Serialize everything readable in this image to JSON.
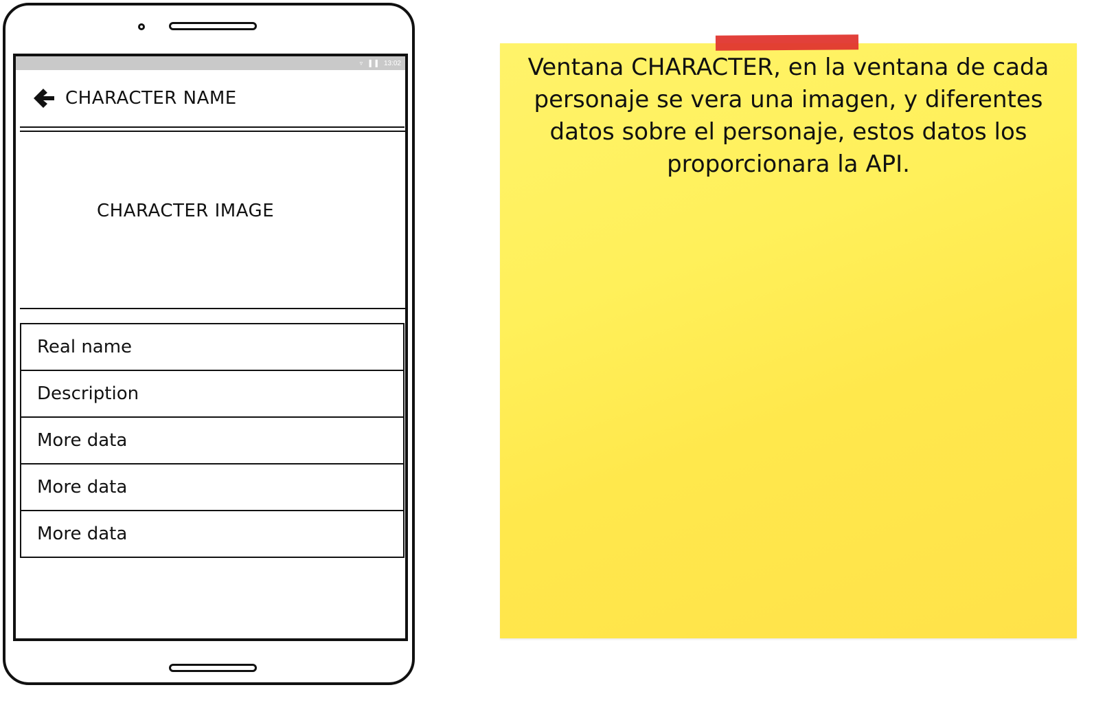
{
  "phone": {
    "status_bar": {
      "time": "13:02",
      "wifi_icon": "wifi-icon",
      "signal_icon": "signal-icon",
      "battery_icon": "battery-icon"
    },
    "app_bar": {
      "back_icon": "arrow-left-icon",
      "title": "CHARACTER NAME"
    },
    "image_placeholder": {
      "label": "CHARACTER IMAGE"
    },
    "data_rows": [
      {
        "label": "Real name"
      },
      {
        "label": "Description"
      },
      {
        "label": "More data"
      },
      {
        "label": "More data"
      },
      {
        "label": "More data"
      }
    ]
  },
  "sticky_note": {
    "text": "Ventana CHARACTER, en la ventana de cada personaje se vera una imagen, y diferentes datos sobre el personaje, estos datos los proporcionara la API.",
    "color": "#fff05a",
    "tape_color": "#e0362f"
  }
}
